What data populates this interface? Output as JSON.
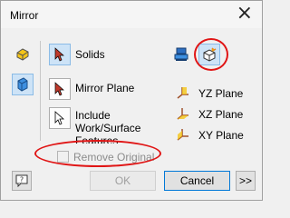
{
  "window": {
    "title": "Mirror"
  },
  "shape_options": {
    "solids_label": "Solids",
    "mirror_plane_label": "Mirror Plane",
    "include_features_label": "Include Work/Surface Features"
  },
  "planes": {
    "yz": "YZ Plane",
    "xz": "XZ Plane",
    "xy": "XY Plane"
  },
  "remove_original": {
    "label": "Remove Original",
    "checked": false,
    "enabled": false
  },
  "buttons": {
    "ok": "OK",
    "cancel": "Cancel",
    "more": ">>"
  },
  "colors": {
    "accent": "#0078d7",
    "highlight": "#e01515",
    "selected_bg": "#cde3f7"
  }
}
